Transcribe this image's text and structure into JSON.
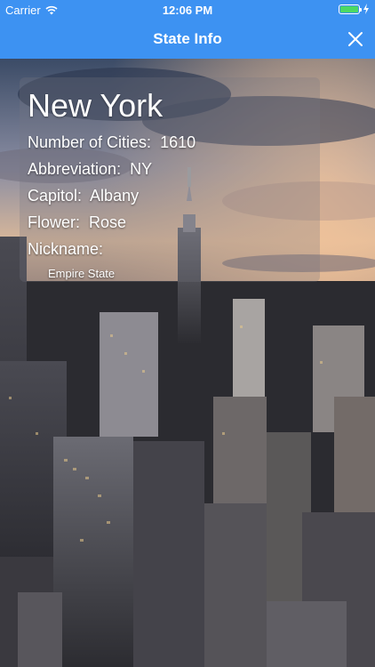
{
  "status_bar": {
    "carrier": "Carrier",
    "time": "12:06 PM",
    "battery_level": 1.0
  },
  "nav": {
    "title": "State Info",
    "close_icon": "close-icon"
  },
  "state": {
    "name": "New York",
    "cities_label": "Number of Cities:",
    "cities_value": "1610",
    "abbreviation_label": "Abbreviation:",
    "abbreviation_value": "NY",
    "capitol_label": "Capitol:",
    "capitol_value": "Albany",
    "flower_label": "Flower:",
    "flower_value": "Rose",
    "nickname_label": "Nickname:",
    "nickname_value": "Empire State"
  },
  "colors": {
    "nav_background": "#3d92f2",
    "battery_fill": "#4cd964"
  }
}
